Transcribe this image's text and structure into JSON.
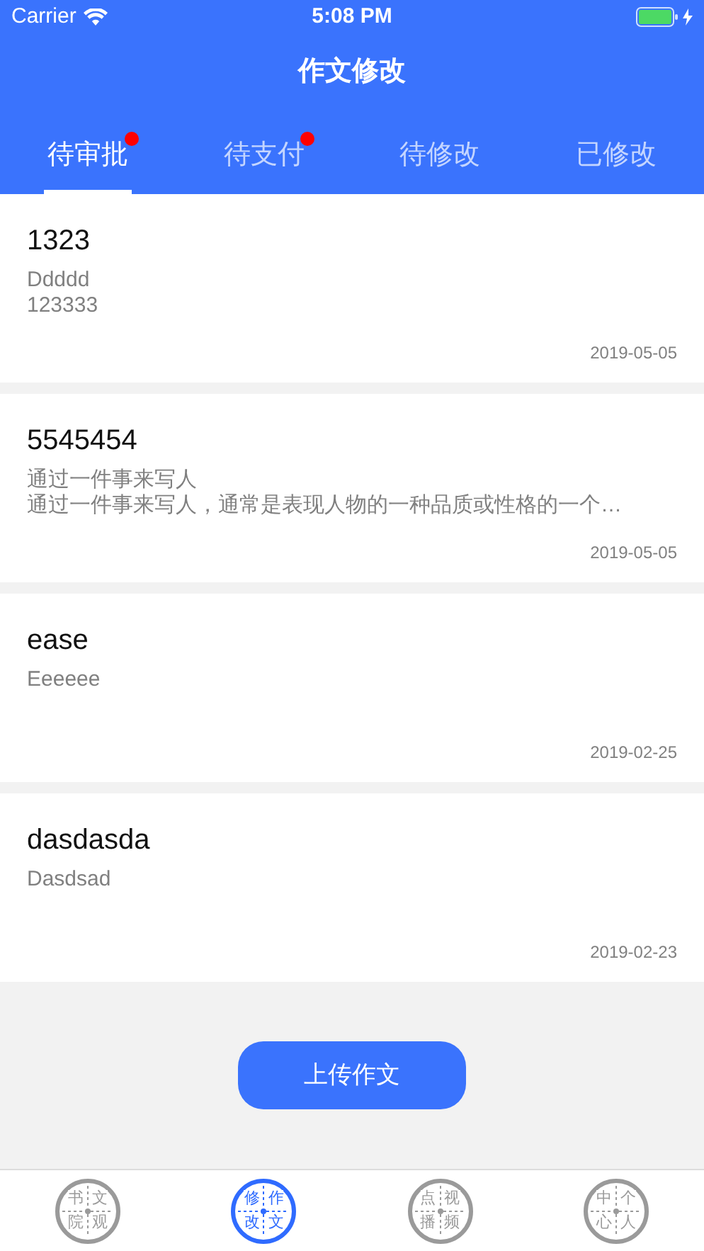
{
  "status_bar": {
    "carrier": "Carrier",
    "time": "5:08 PM"
  },
  "title": "作文修改",
  "tabs": [
    {
      "label": "待审批",
      "selected": true,
      "badge": true
    },
    {
      "label": "待支付",
      "selected": false,
      "badge": true
    },
    {
      "label": "待修改",
      "selected": false,
      "badge": false
    },
    {
      "label": "已修改",
      "selected": false,
      "badge": false
    }
  ],
  "essays": [
    {
      "title": "1323",
      "lines": [
        "Ddddd",
        "123333"
      ],
      "date": "2019-05-05"
    },
    {
      "title": "5545454",
      "lines": [
        "通过一件事来写人",
        "通过一件事来写人，通常是表现人物的一种品质或性格的一个…"
      ],
      "date": "2019-05-05"
    },
    {
      "title": "ease",
      "lines": [
        "Eeeeee"
      ],
      "date": "2019-02-25"
    },
    {
      "title": "dasdasda",
      "lines": [
        "Dasdsad"
      ],
      "date": "2019-02-23"
    }
  ],
  "upload_button": "上传作文",
  "bottom_tabs": [
    {
      "chars": [
        "书",
        "文",
        "院",
        "观"
      ],
      "selected": false
    },
    {
      "chars": [
        "修",
        "作",
        "改",
        "文"
      ],
      "selected": true
    },
    {
      "chars": [
        "点",
        "视",
        "播",
        "频"
      ],
      "selected": false
    },
    {
      "chars": [
        "中",
        "个",
        "心",
        "人"
      ],
      "selected": false
    }
  ]
}
